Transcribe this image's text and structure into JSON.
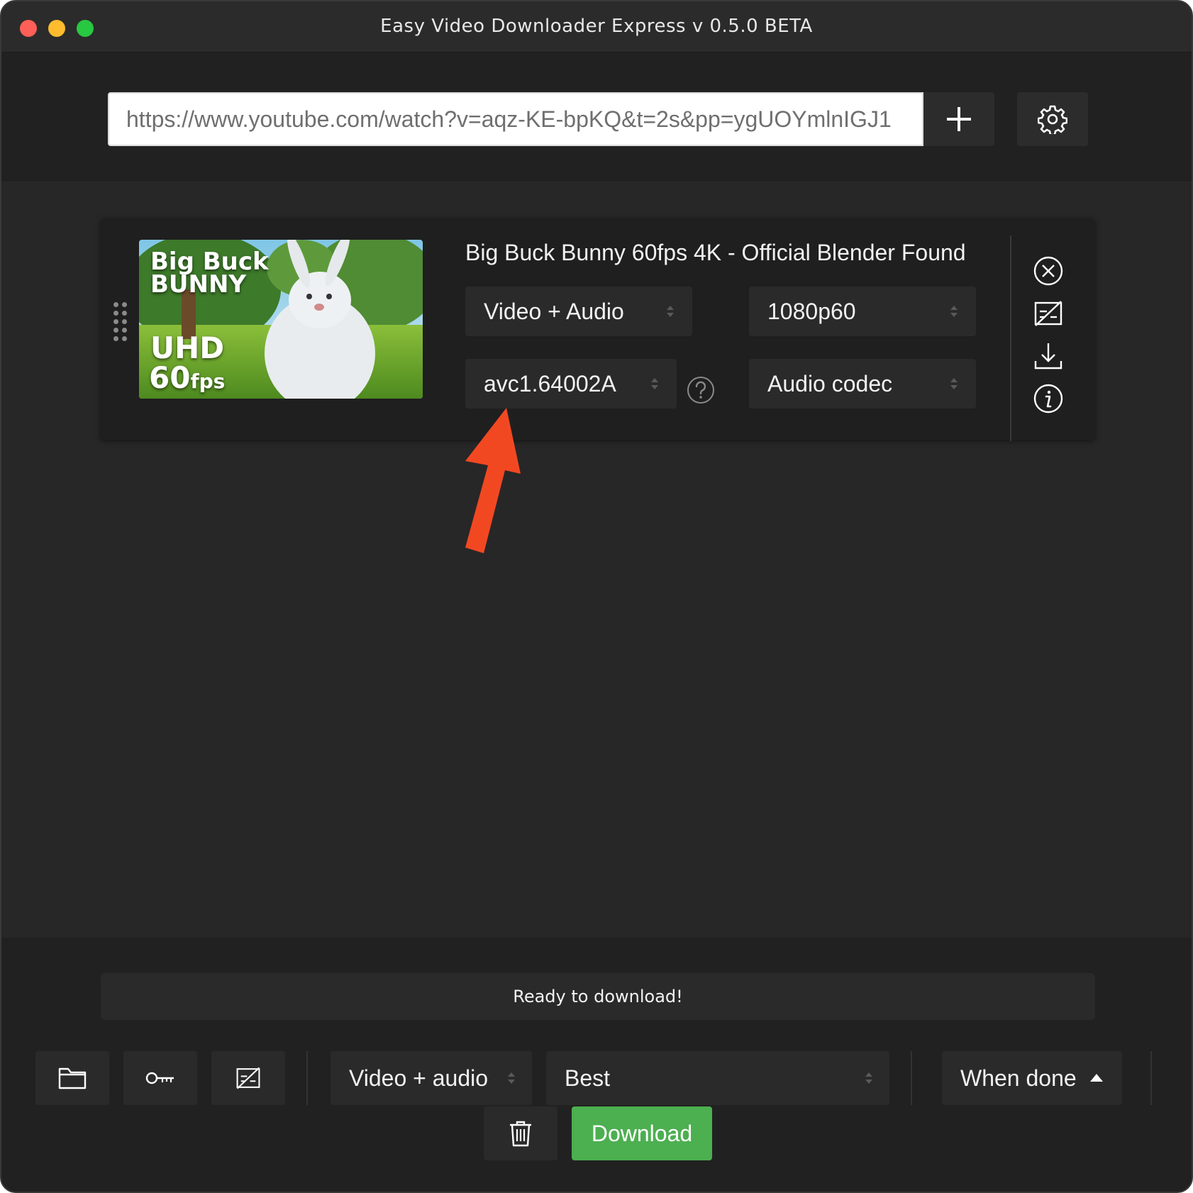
{
  "window": {
    "title": "Easy Video Downloader Express v 0.5.0 BETA"
  },
  "url_bar": {
    "value": "https://www.youtube.com/watch?v=aqz-KE-bpKQ&t=2s&pp=ygUOYmlnIGJ1"
  },
  "item": {
    "thumbnail_text": {
      "line1": "Big Buck",
      "line2": "BUNNY",
      "line3": "UHD",
      "line4": "60",
      "line4_suffix": "fps"
    },
    "title": "Big Buck Bunny 60fps 4K - Official Blender Found",
    "mode": "Video + Audio",
    "resolution": "1080p60",
    "video_codec": "avc1.64002A",
    "audio_codec": "Audio codec"
  },
  "footer": {
    "status": "Ready to download!",
    "mode": "Video + audio",
    "quality": "Best",
    "when_done": "When done",
    "download_label": "Download"
  },
  "colors": {
    "background": "#272727",
    "download": "#4caf50",
    "annotation_arrow": "#f24822"
  }
}
